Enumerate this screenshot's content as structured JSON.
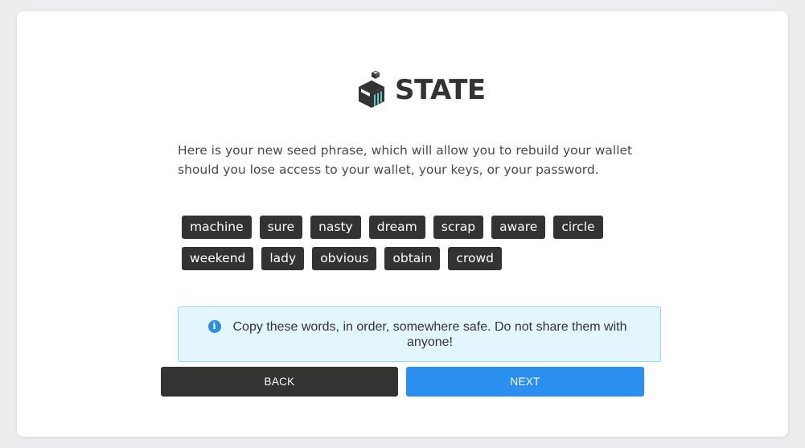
{
  "brand": {
    "name": "STATE",
    "icon": "cube-logo-icon"
  },
  "intro_text": "Here is your new seed phrase, which will allow you to rebuild your wallet should you lose access to your wallet, your keys, or your password.",
  "seed_words": [
    "machine",
    "sure",
    "nasty",
    "dream",
    "scrap",
    "aware",
    "circle",
    "weekend",
    "lady",
    "obvious",
    "obtain",
    "crowd"
  ],
  "notice": {
    "icon": "info-icon",
    "text": "Copy these words, in order, somewhere safe. Do not share them with anyone!"
  },
  "buttons": {
    "back": "BACK",
    "next": "NEXT"
  },
  "colors": {
    "page_background": "#ebedee",
    "card": "#ffffff",
    "dark": "#333333",
    "primary": "#2b8ff0",
    "notice_background": "#e4f6fd",
    "notice_border": "#9bd7ec",
    "logo_accent": "#5cc9c0"
  }
}
